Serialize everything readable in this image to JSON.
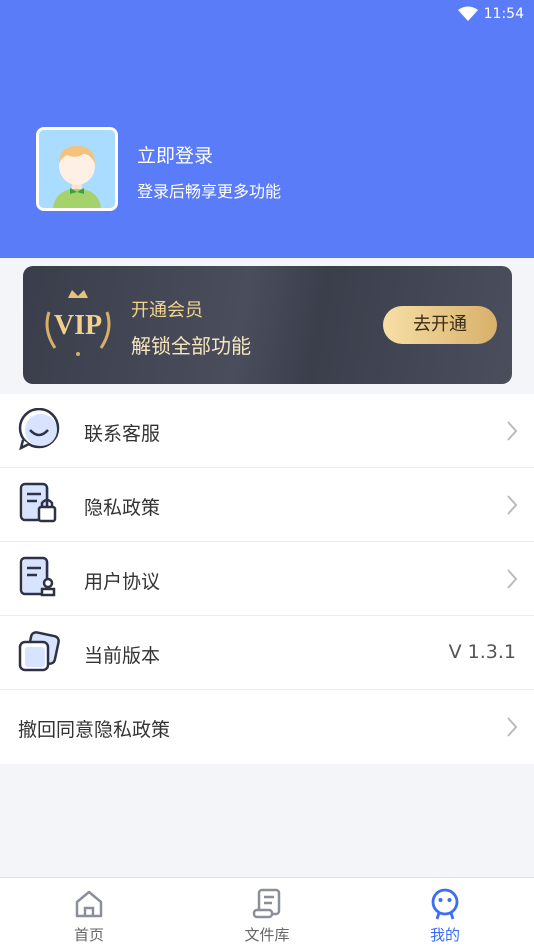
{
  "status_bar": {
    "time": "11:54"
  },
  "profile": {
    "title": "立即登录",
    "subtitle": "登录后畅享更多功能"
  },
  "vip": {
    "badge": "VIP",
    "title": "开通会员",
    "subtitle": "解锁全部功能",
    "button_label": "去开通",
    "colors": {
      "gold": "#f3d48c",
      "card": "#3f4250"
    }
  },
  "menu": {
    "items": [
      {
        "label": "联系客服",
        "icon": "customer-service-icon"
      },
      {
        "label": "隐私政策",
        "icon": "privacy-lock-icon"
      },
      {
        "label": "用户协议",
        "icon": "user-agreement-icon"
      },
      {
        "label": "当前版本",
        "icon": "version-icon",
        "value": "V 1.3.1"
      },
      {
        "label": "撤回同意隐私政策"
      }
    ]
  },
  "tabbar": {
    "tabs": [
      {
        "label": "首页",
        "icon": "home-icon"
      },
      {
        "label": "文件库",
        "icon": "file-library-icon"
      },
      {
        "label": "我的",
        "icon": "mine-icon",
        "active": true
      }
    ]
  },
  "colors": {
    "header": "#5b7cf8",
    "accent": "#3b6df5"
  }
}
